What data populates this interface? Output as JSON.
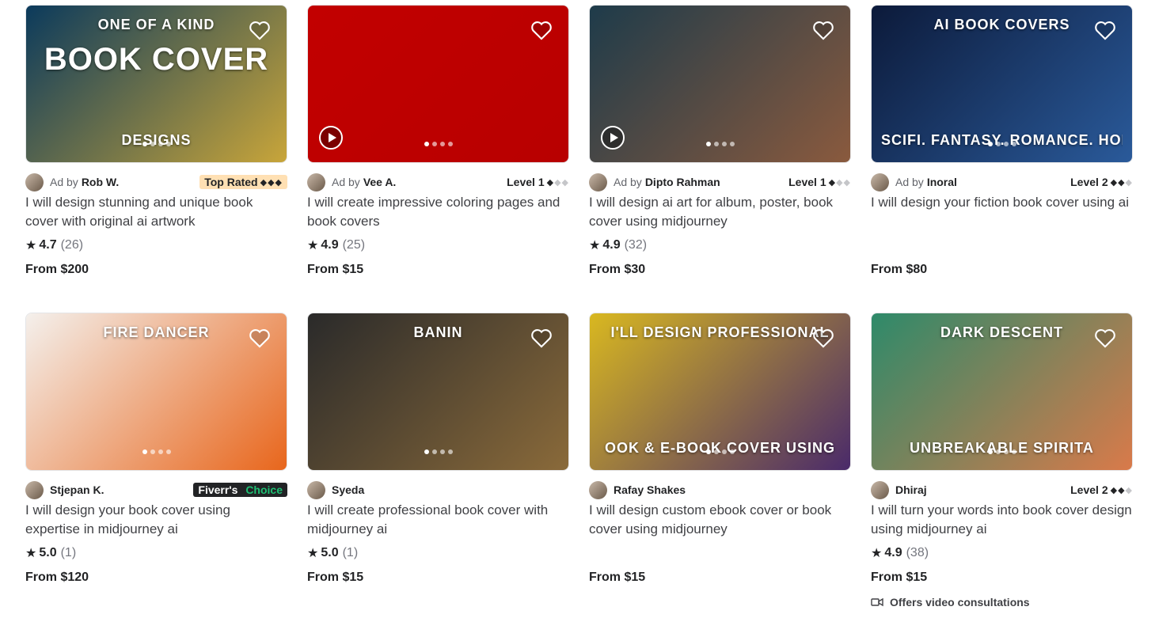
{
  "ui": {
    "ad_by": "Ad by",
    "star": "★",
    "open_paren": "(",
    "close_paren": ")"
  },
  "gigs": [
    {
      "thumb_colors": [
        "#0b3a5c",
        "#c8a53a"
      ],
      "thumb_text": [
        "ONE OF A KIND",
        "BOOK COVER",
        "DESIGNS"
      ],
      "has_play": false,
      "is_ad": true,
      "seller": "Rob W.",
      "badge": "Top Rated",
      "badge_type": "top-rated",
      "diamonds": "◆◆◆",
      "title": "I will design stunning and unique book cover with original ai artwork",
      "rating": "4.7",
      "count": "26",
      "price": "From $200"
    },
    {
      "thumb_colors": [
        "#c20000",
        "#b80000"
      ],
      "thumb_text": [],
      "has_play": true,
      "is_ad": true,
      "seller": "Vee A.",
      "badge": "Level 1",
      "badge_type": "level",
      "diamonds_on": "◆",
      "diamonds_off": "◆◆",
      "title": "I will create impressive coloring pages and book covers",
      "rating": "4.9",
      "count": "25",
      "price": "From $15"
    },
    {
      "thumb_colors": [
        "#1e3b4a",
        "#8a5a3e"
      ],
      "thumb_text": [],
      "has_play": true,
      "is_ad": true,
      "seller": "Dipto Rahman",
      "badge": "Level 1",
      "badge_type": "level",
      "diamonds_on": "◆",
      "diamonds_off": "◆◆",
      "title": "I will design ai art for album, poster, book cover using midjourney",
      "rating": "4.9",
      "count": "32",
      "price": "From $30"
    },
    {
      "thumb_colors": [
        "#0c1a3a",
        "#2a5a9a"
      ],
      "thumb_text": [
        "AI BOOK COVERS",
        "SCIFI. FANTASY. ROMANCE. HORROR+"
      ],
      "has_play": false,
      "is_ad": true,
      "seller": "Inoral",
      "badge": "Level 2",
      "badge_type": "level",
      "diamonds_on": "◆◆",
      "diamonds_off": "◆",
      "title": "I will design your fiction book cover using ai",
      "rating": "",
      "count": "",
      "price": "From $80"
    },
    {
      "thumb_colors": [
        "#f4f0ec",
        "#e8661c"
      ],
      "thumb_text": [
        "FIRE DANCER"
      ],
      "has_play": false,
      "is_ad": false,
      "seller": "Stjepan K.",
      "badge": "Fiverr's",
      "badge2": "Choice",
      "badge_type": "fiverr-choice",
      "title": "I will design your book cover using expertise in midjourney ai",
      "rating": "5.0",
      "count": "1",
      "price": "From $120"
    },
    {
      "thumb_colors": [
        "#2a2a2a",
        "#8a6a3a"
      ],
      "thumb_text": [
        "BANIN"
      ],
      "has_play": false,
      "is_ad": false,
      "seller": "Syeda",
      "badge": "",
      "badge_type": "none",
      "title": "I will create professional book cover with midjourney ai",
      "rating": "5.0",
      "count": "1",
      "price": "From $15"
    },
    {
      "thumb_colors": [
        "#d9b820",
        "#4a2a6a"
      ],
      "thumb_text": [
        "I'LL DESIGN PROFESSIONAL",
        "OOK & E-BOOK COVER USING"
      ],
      "has_play": false,
      "is_ad": false,
      "seller": "Rafay Shakes",
      "badge": "",
      "badge_type": "none",
      "title": "I will design custom ebook cover or book cover using midjourney",
      "rating": "",
      "count": "",
      "price": "From $15"
    },
    {
      "thumb_colors": [
        "#2e8a6a",
        "#d97a4a"
      ],
      "thumb_text": [
        "DARK DESCENT",
        "UNBREAKABLE SPIRITA"
      ],
      "has_play": false,
      "is_ad": false,
      "seller": "Dhiraj",
      "badge": "Level 2",
      "badge_type": "level",
      "diamonds_on": "◆◆",
      "diamonds_off": "◆",
      "title": "I will turn your words into book cover design using midjourney ai",
      "rating": "4.9",
      "count": "38",
      "price": "From $15",
      "extra": "Offers video consultations"
    }
  ]
}
